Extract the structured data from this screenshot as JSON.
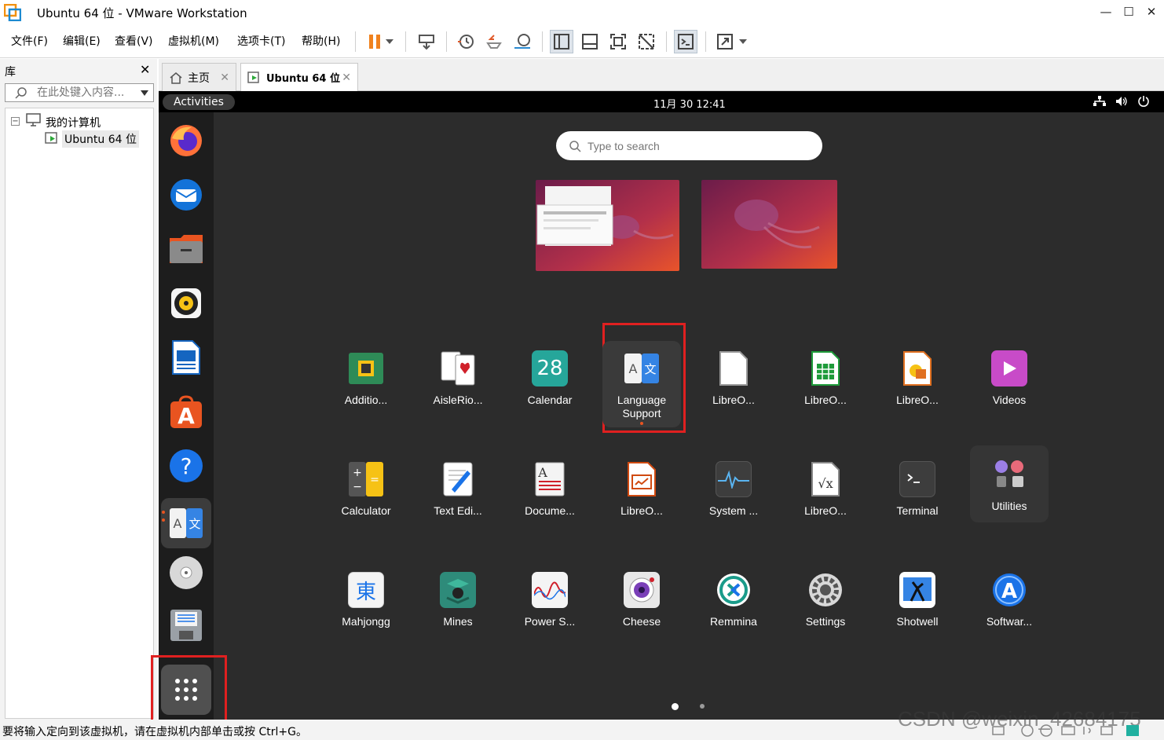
{
  "window": {
    "title": "Ubuntu 64 位 - VMware Workstation"
  },
  "menu": [
    "文件(F)",
    "编辑(E)",
    "查看(V)",
    "虚拟机(M)",
    "选项卡(T)",
    "帮助(H)"
  ],
  "library": {
    "title": "库",
    "search_placeholder": "在此处键入内容...",
    "tree_root": "我的计算机",
    "tree_child": "Ubuntu 64 位"
  },
  "tabs": [
    {
      "label": "主页"
    },
    {
      "label": "Ubuntu 64 位"
    }
  ],
  "vm": {
    "activities": "Activities",
    "clock": "11月 30  12:41",
    "search_placeholder": "Type to search",
    "apps": [
      {
        "label": "Additio..."
      },
      {
        "label": "AisleRio..."
      },
      {
        "label": "Calendar",
        "badge": "28"
      },
      {
        "label": "Language\nSupport"
      },
      {
        "label": "LibreO..."
      },
      {
        "label": "LibreO..."
      },
      {
        "label": "LibreO..."
      },
      {
        "label": "Videos"
      },
      {
        "label": "Calculator"
      },
      {
        "label": "Text Edi..."
      },
      {
        "label": "Docume..."
      },
      {
        "label": "LibreO..."
      },
      {
        "label": "System ..."
      },
      {
        "label": "LibreO..."
      },
      {
        "label": "Terminal"
      },
      {
        "label": "Utilities"
      },
      {
        "label": "Mahjongg",
        "glyph": "東"
      },
      {
        "label": "Mines"
      },
      {
        "label": "Power S..."
      },
      {
        "label": "Cheese"
      },
      {
        "label": "Remmina"
      },
      {
        "label": "Settings"
      },
      {
        "label": "Shotwell"
      },
      {
        "label": "Softwar..."
      }
    ]
  },
  "statusbar": {
    "text": "要将输入定向到该虚拟机，请在虚拟机内部单击或按 Ctrl+G。"
  },
  "watermark": "CSDN @weixin_42684175",
  "colors": {
    "accent": "#e95420",
    "highlight": "#e02020"
  }
}
